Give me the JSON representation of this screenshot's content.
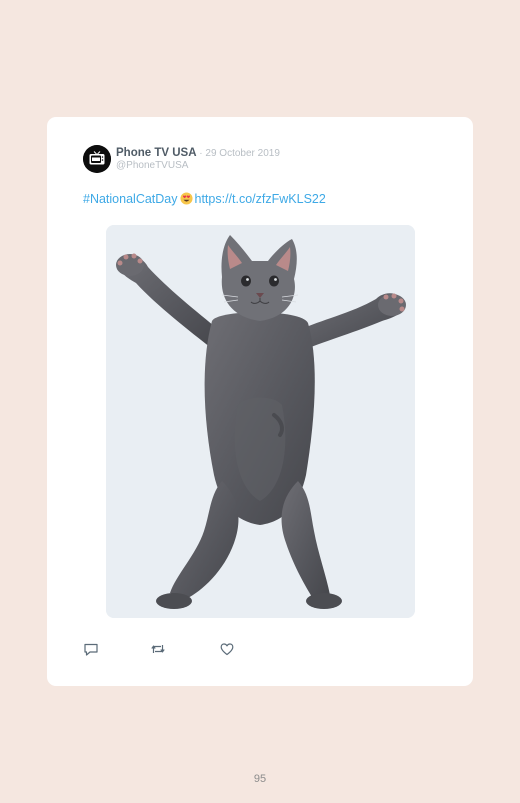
{
  "tweet": {
    "author_name": "Phone TV USA",
    "separator": " · ",
    "date": "29 October 2019",
    "handle": "@PhoneTVUSA",
    "hashtag": "#NationalCatDay",
    "emoji_icon": "smiling-face-with-heart-eyes-icon",
    "link": "https://t.co/zfzFwKLS22",
    "media_icon": "dancing-cat-photo",
    "actions": [
      "reply-icon",
      "retweet-icon",
      "like-icon"
    ]
  },
  "colors": {
    "page_background": "#f5e7e0",
    "card_background": "#ffffff",
    "link": "#3ea9e6",
    "name": "#4f5b66",
    "meta": "#b8bec4"
  },
  "footer": {
    "page_number": "95"
  }
}
